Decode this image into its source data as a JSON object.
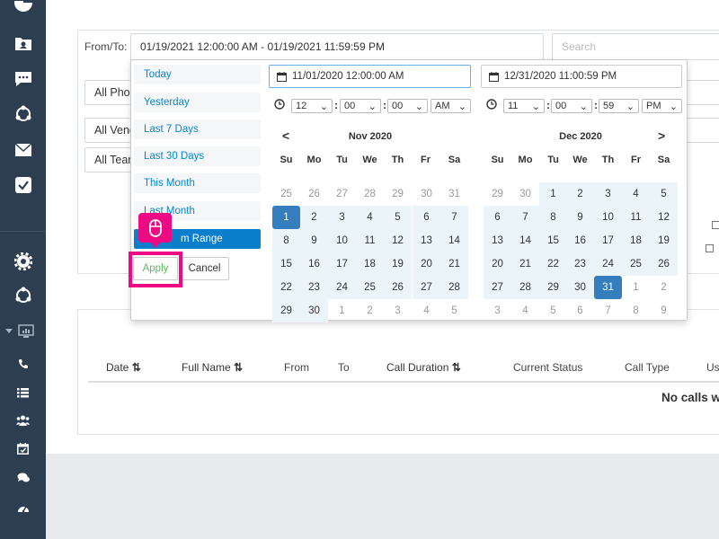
{
  "filters": {
    "from_to_label": "From/To:",
    "from_to_value": "01/19/2021 12:00:00 AM - 01/19/2021 11:59:59 PM",
    "search_placeholder": "Search",
    "phone_select": "All Pho",
    "vendor_select": "All Venc",
    "team_select": "All Tean"
  },
  "picker": {
    "ranges": [
      "Today",
      "Yesterday",
      "Last 7 Days",
      "Last 30 Days",
      "This Month",
      "Last Month",
      "Custom Range"
    ],
    "custom_range_visible": "m Range",
    "apply_label": "Apply",
    "cancel_label": "Cancel",
    "start_date": "11/01/2020 12:00:00 AM",
    "end_date": "12/31/2020 11:00:59 PM",
    "start_time": {
      "hour": "12",
      "minute": "00",
      "second": "00",
      "ampm": "AM"
    },
    "end_time": {
      "hour": "11",
      "minute": "00",
      "second": "59",
      "ampm": "PM"
    },
    "weekdays": [
      "Su",
      "Mo",
      "Tu",
      "We",
      "Th",
      "Fr",
      "Sa"
    ],
    "left_calendar": {
      "title": "Nov 2020",
      "prev": "<",
      "days": [
        "25",
        "26",
        "27",
        "28",
        "29",
        "30",
        "31",
        "1",
        "2",
        "3",
        "4",
        "5",
        "6",
        "7",
        "8",
        "9",
        "10",
        "11",
        "12",
        "13",
        "14",
        "15",
        "16",
        "17",
        "18",
        "19",
        "20",
        "21",
        "22",
        "23",
        "24",
        "25",
        "26",
        "27",
        "28",
        "29",
        "30",
        "1",
        "2",
        "3",
        "4",
        "5"
      ]
    },
    "right_calendar": {
      "title": "Dec 2020",
      "next": ">",
      "days": [
        "29",
        "30",
        "1",
        "2",
        "3",
        "4",
        "5",
        "6",
        "7",
        "8",
        "9",
        "10",
        "11",
        "12",
        "13",
        "14",
        "15",
        "16",
        "17",
        "18",
        "19",
        "20",
        "21",
        "22",
        "23",
        "24",
        "25",
        "26",
        "27",
        "28",
        "29",
        "30",
        "31",
        "1",
        "2",
        "3",
        "4",
        "5",
        "6",
        "7",
        "8",
        "9"
      ]
    }
  },
  "table": {
    "columns": [
      "Date",
      "Full Name",
      "From",
      "To",
      "Call Duration",
      "Current Status",
      "Call Type",
      "Us"
    ],
    "empty_message": "No calls w"
  },
  "colors": {
    "sidebar": "#2c3e50",
    "accent": "#0b7fcb",
    "selected_day": "#357ebd",
    "in_range": "#ebf4f8",
    "highlight": "#ef0a84",
    "apply_text": "#5cb85c"
  },
  "icons": {
    "sidebar": [
      "pie-chart-icon",
      "contacts-icon",
      "chat-icon",
      "network-icon",
      "mail-icon",
      "checkbox-icon",
      "gear-icon",
      "network-icon",
      "monitor-icon",
      "phone-icon",
      "list-icon",
      "users-icon",
      "calendar-icon",
      "comments-icon",
      "dashboard-icon"
    ],
    "overlay": "mouse-icon"
  }
}
